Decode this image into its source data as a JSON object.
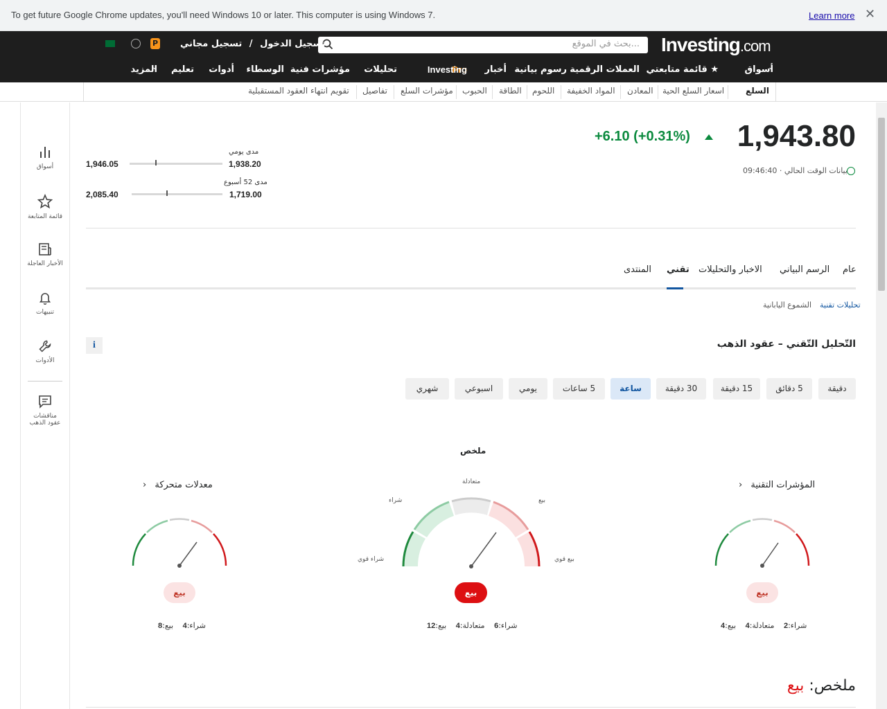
{
  "browser_bar": {
    "message": "To get future Google Chrome updates, you'll need Windows 10 or later. This computer is using Windows 7.",
    "learn_more": "Learn more",
    "close": "✕"
  },
  "header": {
    "logo_main": "Investing",
    "logo_suffix": ".com",
    "search_placeholder": "بحث في الموقع...",
    "signin": "تسجيل الدخول",
    "separator": "/",
    "signup": "تسجيل مجاني"
  },
  "nav": {
    "markets": "أسواق",
    "watchlist": "★ قائمة متابعتي",
    "crypto": "العملات الرقمية",
    "charts": "رسوم بيانية",
    "news": "أخبار",
    "pro_investing": "Investing",
    "pro_suffix": "Pro",
    "analysis": "تحليلات",
    "technical": "مؤشرات فنية",
    "brokers": "الوسطاء",
    "tools": "أدوات",
    "education": "تعليم",
    "more": "المزيد"
  },
  "subnav": {
    "items": [
      "السلع",
      "اسعار السلع الحية",
      "المعادن",
      "المواد الخفيفة",
      "اللحوم",
      "الطاقة",
      "الحبوب",
      "مؤشرات السلع",
      "تفاصيل",
      "تقويم انتهاء العقود المستقبلية"
    ]
  },
  "sidebar": {
    "items": [
      "أسواق",
      "قائمة المتابعة",
      "الأخبار العاجلة",
      "تنبيهات",
      "الأدوات",
      "مناقشات عقود الذهب"
    ]
  },
  "quote": {
    "price": "1,943.80",
    "change": "+6.10",
    "change_pct": "(+0.31%)",
    "time_label": "بيانات الوقت الحالي ·",
    "time": "09:46:40",
    "day_range_label": "مدى يومي",
    "day_low": "1,938.20",
    "day_high": "1,946.05",
    "week52_label": "مدى 52 أسبوع",
    "week52_low": "1,719.00",
    "week52_high": "2,085.40"
  },
  "tabs": {
    "general": "عام",
    "chart": "الرسم البياني",
    "news": "الاخبار والتحليلات",
    "technical": "تقني",
    "forum": "المنتدى"
  },
  "subtabs": {
    "technical_analysis": "تحليلات تقنية",
    "candles": "الشموع اليابانية"
  },
  "section": {
    "title": "التّحليل التّقني – عقود الذهب",
    "info": "i"
  },
  "timeframes": [
    "دقيقة",
    "5 دقائق",
    "15 دقيقة",
    "30 دقيقة",
    "ساعة",
    "5 ساعات",
    "يومي",
    "اسبوعي",
    "شهري"
  ],
  "active_timeframe": "ساعة",
  "summary_gauge": {
    "title": "ملخص",
    "label_neutral": "متعادلة",
    "label_buy": "شراء",
    "label_sell": "بيع",
    "label_strong_buy": "شراء قوي",
    "label_strong_sell": "بيع قوي",
    "signal": "بيع",
    "buy_label": "شراء:",
    "buy": "6",
    "neutral_label": "متعادلة:",
    "neutral": "4",
    "sell_label": "بيع:",
    "sell": "12"
  },
  "indicators_gauge": {
    "title": "المؤشرات التقنية",
    "signal": "بيع",
    "buy_label": "شراء:",
    "buy": "2",
    "neutral_label": "متعادلة:",
    "neutral": "4",
    "sell_label": "بيع:",
    "sell": "4"
  },
  "ma_gauge": {
    "title": "معدلات متحركة",
    "signal": "بيع",
    "buy_label": "شراء:",
    "buy": "4",
    "sell_label": "بيع:",
    "sell": "8"
  },
  "bottom_summary": {
    "label": "ملخص:",
    "value": "بيع"
  },
  "colors": {
    "positive": "#0b8a3e",
    "negative": "#dd0f12",
    "accent": "#1256a0",
    "pro_orange": "#f7931a"
  }
}
